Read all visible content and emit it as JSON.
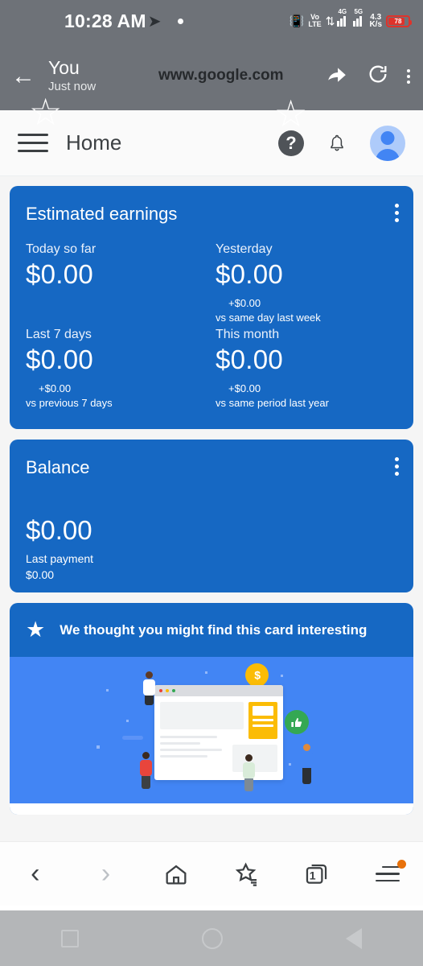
{
  "status_bar": {
    "time": "10:28 AM",
    "telegram_icon": "telegram-plane-icon",
    "notification_dot": "•",
    "vibrate_icon": "vibrate-icon",
    "volte_line1": "Vo",
    "volte_line2": "LTE",
    "data_arrows": "⇵",
    "network_1": "4G",
    "network_2": "5G",
    "data_rate_value": "4.3",
    "data_rate_unit": "K/s",
    "battery_percent": "78"
  },
  "browser_header": {
    "back_icon": "back-arrow-icon",
    "title": "You",
    "subtitle": "Just now",
    "url": "www.google.com",
    "bookmark_icon": "star-icon",
    "share_icon": "share-arrow-icon",
    "refresh_icon": "refresh-icon",
    "overflow_icon": "more-vertical-icon"
  },
  "app_bar": {
    "menu_icon": "hamburger-menu-icon",
    "title": "Home",
    "help_icon": "help-question-icon",
    "help_glyph": "?",
    "notifications_icon": "bell-icon",
    "avatar_icon": "account-avatar-icon"
  },
  "earnings_card": {
    "title": "Estimated earnings",
    "overflow_icon": "more-vertical-icon",
    "metrics": [
      {
        "label": "Today so far",
        "value": "$0.00",
        "delta": "",
        "delta_note": ""
      },
      {
        "label": "Yesterday",
        "value": "$0.00",
        "delta": "+$0.00",
        "delta_note": "vs same day last week"
      },
      {
        "label": "Last 7 days",
        "value": "$0.00",
        "delta": "+$0.00",
        "delta_note": "vs previous 7 days"
      },
      {
        "label": "This month",
        "value": "$0.00",
        "delta": "+$0.00",
        "delta_note": "vs same period last year"
      }
    ]
  },
  "balance_card": {
    "title": "Balance",
    "overflow_icon": "more-vertical-icon",
    "value": "$0.00",
    "last_payment_label": "Last payment",
    "last_payment_value": "$0.00"
  },
  "suggestion_card": {
    "star_icon": "star-filled-icon",
    "text": "We thought you might find this card interesting",
    "illustration": "adsense-website-monetization-illustration",
    "illustration_money_glyph": "$",
    "illustration_thumb_glyph": "👍"
  },
  "browser_toolbar": {
    "back_icon": "chevron-left-icon",
    "back_glyph": "‹",
    "forward_icon": "chevron-right-icon",
    "forward_glyph": "›",
    "home_icon": "home-icon",
    "bookmarks_icon": "bookmarks-star-icon",
    "tabs_icon": "tab-switcher-icon",
    "tab_count": "1",
    "menu_icon": "hamburger-menu-icon",
    "menu_badge": "update-dot"
  },
  "android_nav": {
    "recents_icon": "recents-square-icon",
    "home_icon": "home-circle-icon",
    "back_icon": "back-triangle-icon"
  },
  "colors": {
    "card_blue": "#1668c3",
    "illustration_blue": "#4285f4",
    "overlay_gray": "#6e7278",
    "nav_gray": "#b4b6b8",
    "badge_orange": "#e8710a",
    "battery_red": "#e0322a"
  }
}
